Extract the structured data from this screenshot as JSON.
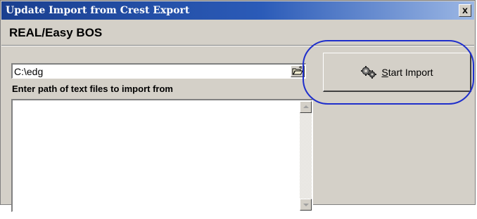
{
  "window": {
    "title": "Update Import from Crest Export",
    "close_label": "x"
  },
  "header": {
    "label": "REAL/Easy BOS"
  },
  "path": {
    "value": "C:\\edg",
    "hint": "Enter path of text files to import from",
    "browse_icon": "folder-open-icon"
  },
  "log": {
    "value": ""
  },
  "import_button": {
    "icon": "gears-icon",
    "mnemonic": "S",
    "label_rest": "tart Import"
  },
  "colors": {
    "dialog_bg": "#d4d0c8",
    "title_start": "#1a3f8f",
    "title_end": "#9cb7e4",
    "highlight": "#1f2fcc"
  }
}
